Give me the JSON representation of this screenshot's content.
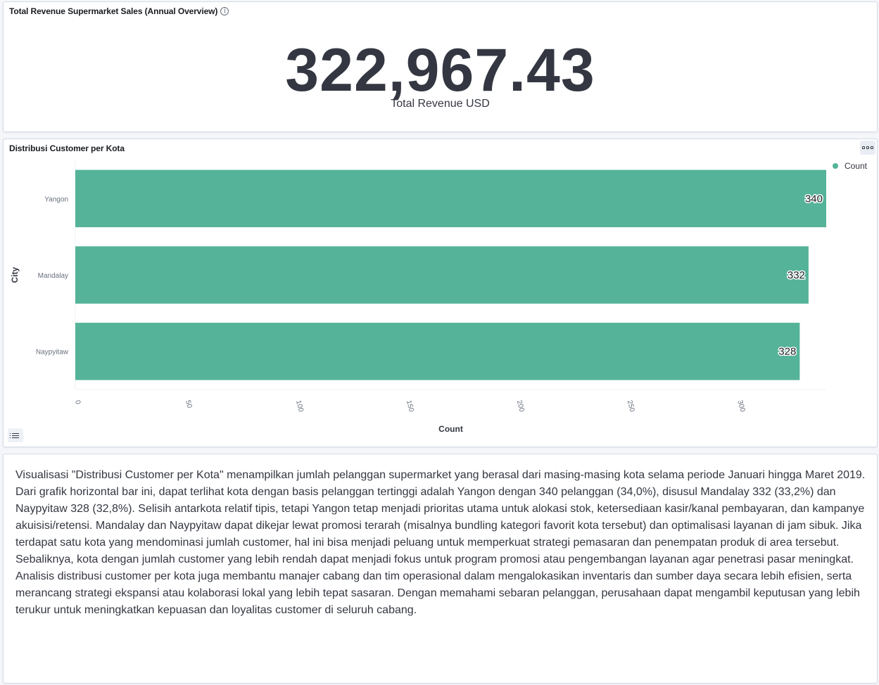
{
  "metric_panel": {
    "title": "Total Revenue Supermarket Sales (Annual Overview)",
    "info_icon": "info-icon",
    "value": "322,967.43",
    "label": "Total Revenue USD"
  },
  "chart_panel": {
    "title": "Distribusi Customer per Kota",
    "options_icon": "ellipsis-icon",
    "legend_toggle_icon": "list-icon"
  },
  "chart_data": {
    "type": "bar",
    "orientation": "horizontal",
    "categories": [
      "Yangon",
      "Mandalay",
      "Naypyitaw"
    ],
    "series": [
      {
        "name": "Count",
        "values": [
          340,
          332,
          328
        ],
        "color": "#54b399"
      }
    ],
    "data_labels": [
      "340",
      "332",
      "328"
    ],
    "xlabel": "Count",
    "ylabel": "City",
    "xlim": [
      0,
      340
    ],
    "xticks": [
      "0",
      "50",
      "100",
      "150",
      "200",
      "250",
      "300"
    ],
    "legend_position": "top-right",
    "grid": false
  },
  "text_panel": {
    "description": "Visualisasi \"Distribusi Customer per Kota\" menampilkan jumlah pelanggan supermarket yang berasal dari masing-masing kota selama periode Januari hingga Maret 2019. Dari grafik horizontal bar ini, dapat terlihat kota dengan basis pelanggan tertinggi adalah Yangon dengan 340 pelanggan (34,0%), disusul Mandalay 332 (33,2%) dan Naypyitaw 328 (32,8%). Selisih antarkota relatif tipis, tetapi Yangon tetap menjadi prioritas utama untuk alokasi stok, ketersediaan kasir/kanal pembayaran, dan kampanye akuisisi/retensi. Mandalay dan Naypyitaw dapat dikejar lewat promosi terarah (misalnya bundling kategori favorit kota tersebut) dan optimalisasi layanan di jam sibuk. Jika terdapat satu kota yang mendominasi jumlah customer, hal ini bisa menjadi peluang untuk memperkuat strategi pemasaran dan penempatan produk di area tersebut. Sebaliknya, kota dengan jumlah customer yang lebih rendah dapat menjadi fokus untuk program promosi atau pengembangan layanan agar penetrasi pasar meningkat. Analisis distribusi customer per kota juga membantu manajer cabang dan tim operasional dalam mengalokasikan inventaris dan sumber daya secara lebih efisien, serta merancang strategi ekspansi atau kolaborasi lokal yang lebih tepat sasaran. Dengan memahami sebaran pelanggan, perusahaan dapat mengambil keputusan yang lebih terukur untuk meningkatkan kepuasan dan loyalitas customer di seluruh cabang."
  }
}
